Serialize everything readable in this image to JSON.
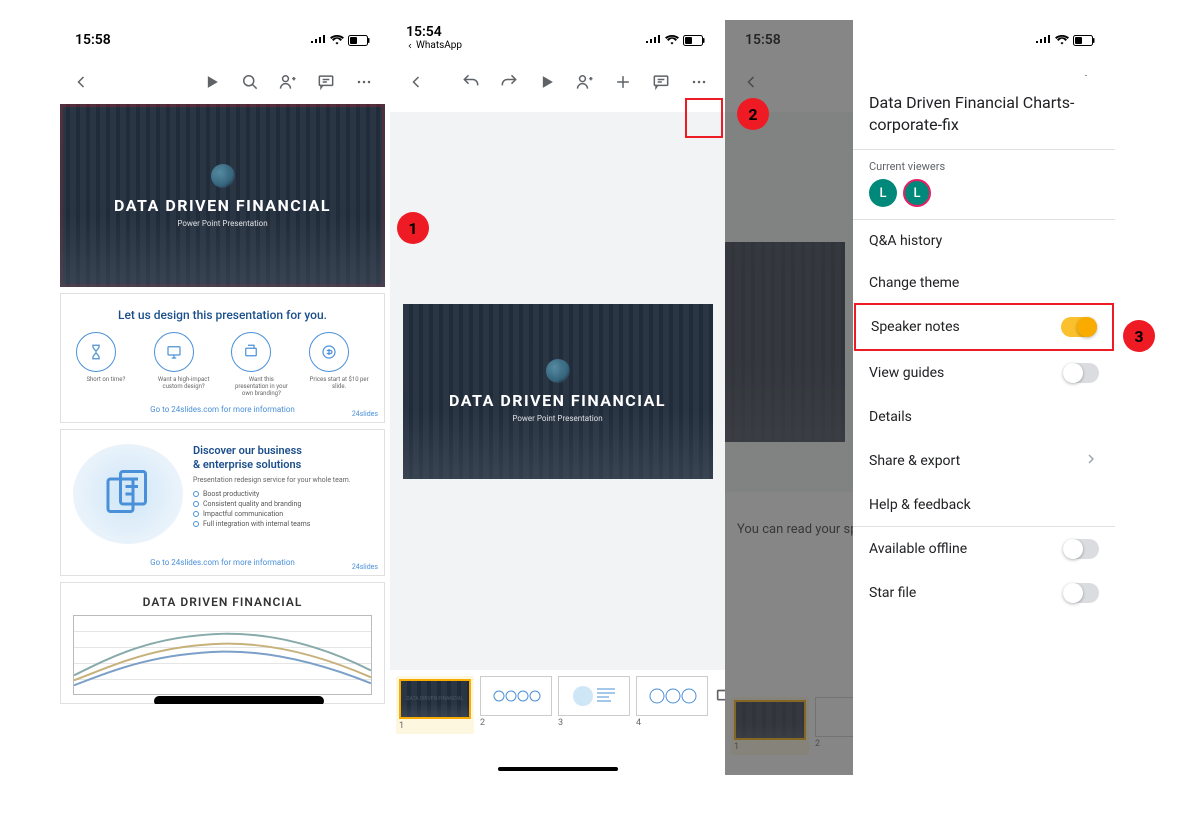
{
  "status": {
    "time1": "15:58",
    "time2": "15:54",
    "time3": "15:58",
    "back_app": "WhatsApp"
  },
  "slide_main": {
    "title": "DATA DRIVEN FINANCIAL",
    "subtitle": "Power Point Presentation"
  },
  "slide2": {
    "head": "Let us design this presentation for you.",
    "labels": [
      "Short\non time?",
      "Want a high-impact\ncustom design?",
      "Want this presentation in your\nown branding?",
      "Prices start at\n$10 per slide."
    ],
    "foot": "Go to 24slides.com for more information",
    "brand": "24slides"
  },
  "slide3": {
    "title1": "Discover our business",
    "title2": "& enterprise solutions",
    "sub": "Presentation redesign service for your whole team.",
    "bullets": [
      "Boost productivity",
      "Consistent quality and branding",
      "Impactful communication",
      "Full integration with internal teams"
    ],
    "foot": "Go to 24slides.com for more information",
    "brand": "24slides"
  },
  "slide4": {
    "title": "DATA DRIVEN FINANCIAL"
  },
  "filmstrip": {
    "nums": [
      "1",
      "2",
      "3",
      "4"
    ]
  },
  "panel3": {
    "notes_text": "You can read your sp",
    "thumb_nums": [
      "1",
      "2"
    ]
  },
  "menu": {
    "file_title": "Data Driven Financial Charts-corporate-fix",
    "viewers_label": "Current viewers",
    "avatar1": "L",
    "avatar2": "L",
    "items": {
      "qa": "Q&A history",
      "theme": "Change theme",
      "speaker": "Speaker notes",
      "guides": "View guides",
      "details": "Details",
      "share": "Share & export",
      "help": "Help & feedback",
      "offline": "Available offline",
      "star": "Star file"
    }
  },
  "callouts": {
    "c1": "1",
    "c2": "2",
    "c3": "3"
  }
}
